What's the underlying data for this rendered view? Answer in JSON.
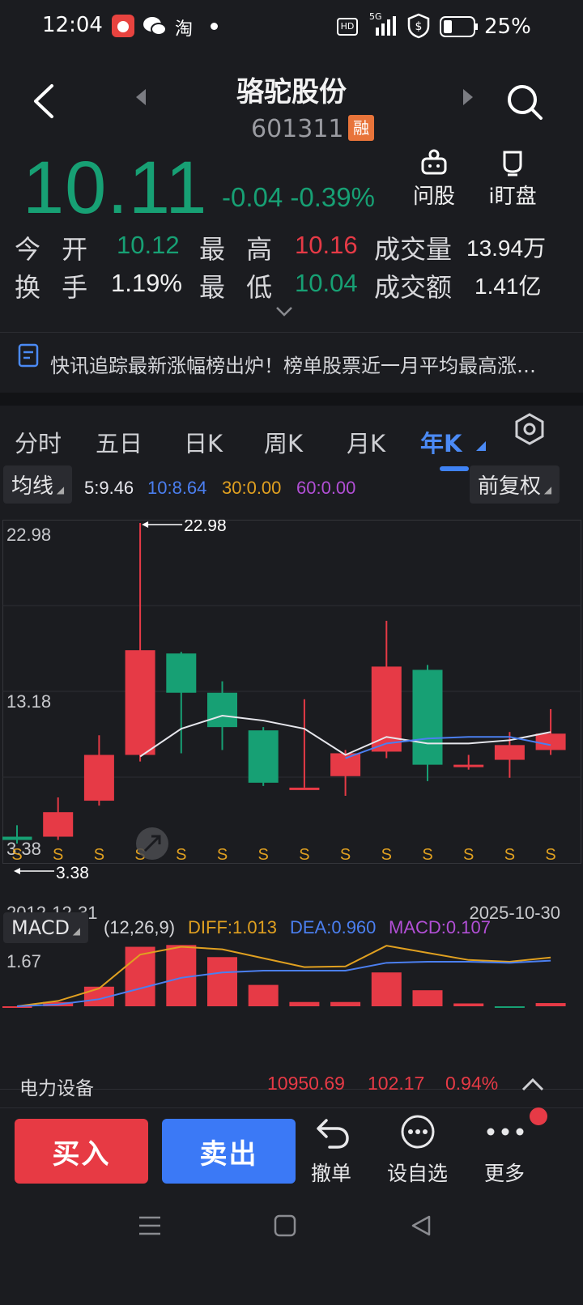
{
  "status": {
    "time": "12:04",
    "battery": "25%",
    "app_icons": [
      "app-icon",
      "wechat-icon",
      "taobao-icon"
    ],
    "taobao_label": "淘",
    "network": "5G",
    "hd": "HD"
  },
  "header": {
    "stock_name": "骆驼股份",
    "stock_code": "601311",
    "badge": "融"
  },
  "quote": {
    "price": "10.11",
    "change": "-0.04 -0.39%",
    "ask_label": "问股",
    "watch_label": "i盯盘"
  },
  "stats": {
    "open_label": "今 开",
    "open_value": "10.12",
    "high_label": "最 高",
    "high_value": "10.16",
    "volume_label": "成交量",
    "volume_value": "13.94万",
    "turnover_label": "换 手",
    "turnover_value": "1.19%",
    "low_label": "最 低",
    "low_value": "10.04",
    "amount_label": "成交额",
    "amount_value": "1.41亿"
  },
  "news": {
    "text": "快讯追踪最新涨幅榜出炉！榜单股票近一月平均最高涨…"
  },
  "tabs": [
    {
      "label": "分时"
    },
    {
      "label": "五日"
    },
    {
      "label": "日K"
    },
    {
      "label": "周K"
    },
    {
      "label": "月K"
    },
    {
      "label": "年K"
    }
  ],
  "indicators": {
    "ma_pill": "均线",
    "ma5": "5:9.46",
    "ma10": "10:8.64",
    "ma30": "30:0.00",
    "ma60": "60:0.00",
    "adjust_pill": "前复权"
  },
  "colors": {
    "up": "#e63a46",
    "down": "#17a074",
    "ma5": "#e6e6ec",
    "ma10": "#4b7ff0",
    "ma30": "#e0a020",
    "ma60": "#b24fd6",
    "blue_accent": "#3f82f4"
  },
  "chart_data": [
    {
      "type": "candlestick",
      "title": "",
      "yticks": [
        "22.98",
        "13.18",
        "3.38"
      ],
      "ylim": [
        3.38,
        22.98
      ],
      "max_annotation": "22.98",
      "min_annotation": "3.38",
      "x_start": "2012-12-31",
      "x_end": "2025-10-30",
      "marker_label": "S",
      "candles": [
        {
          "open": 3.8,
          "close": 3.6,
          "high": 4.5,
          "low": 3.38,
          "dir": "down"
        },
        {
          "open": 3.8,
          "close": 5.3,
          "high": 6.2,
          "low": 3.6,
          "dir": "up"
        },
        {
          "open": 6.0,
          "close": 8.8,
          "high": 10.0,
          "low": 5.7,
          "dir": "up"
        },
        {
          "open": 8.8,
          "close": 15.2,
          "high": 22.98,
          "low": 8.4,
          "dir": "up"
        },
        {
          "open": 15.0,
          "close": 12.6,
          "high": 15.1,
          "low": 8.9,
          "dir": "down"
        },
        {
          "open": 12.6,
          "close": 10.5,
          "high": 13.3,
          "low": 9.1,
          "dir": "down"
        },
        {
          "open": 10.3,
          "close": 7.1,
          "high": 10.5,
          "low": 6.9,
          "dir": "down"
        },
        {
          "open": 6.8,
          "close": 6.8,
          "high": 12.2,
          "low": 6.8,
          "dir": "up"
        },
        {
          "open": 7.5,
          "close": 8.9,
          "high": 9.1,
          "low": 6.3,
          "dir": "up"
        },
        {
          "open": 9.0,
          "close": 14.2,
          "high": 17.0,
          "low": 8.6,
          "dir": "up"
        },
        {
          "open": 14.0,
          "close": 8.2,
          "high": 14.3,
          "low": 7.2,
          "dir": "down"
        },
        {
          "open": 8.1,
          "close": 8.2,
          "high": 8.8,
          "low": 7.9,
          "dir": "up"
        },
        {
          "open": 8.5,
          "close": 9.4,
          "high": 10.2,
          "low": 7.4,
          "dir": "up"
        },
        {
          "open": 9.1,
          "close": 10.1,
          "high": 11.6,
          "low": 8.8,
          "dir": "up"
        }
      ],
      "ma5": [
        null,
        null,
        null,
        8.7,
        10.4,
        11.2,
        10.9,
        10.4,
        8.8,
        9.9,
        9.5,
        9.5,
        9.7,
        10.2
      ],
      "ma10": [
        null,
        null,
        null,
        null,
        null,
        null,
        null,
        null,
        8.6,
        9.5,
        9.8,
        9.9,
        9.9,
        9.4
      ]
    },
    {
      "type": "bar",
      "title": "",
      "name": "MACD",
      "params": "(12,26,9)",
      "diff_label": "DIFF:1.013",
      "dea_label": "DEA:0.960",
      "macd_label": "MACD:0.107",
      "ytick": "1.67",
      "values": [
        0.0,
        0.12,
        0.55,
        1.67,
        1.72,
        1.38,
        0.6,
        0.12,
        0.12,
        0.95,
        0.45,
        0.08,
        -0.02,
        0.09
      ],
      "diff": [
        0.0,
        0.15,
        0.5,
        1.45,
        1.67,
        1.6,
        1.35,
        1.1,
        1.12,
        1.7,
        1.5,
        1.3,
        1.25,
        1.37
      ],
      "dea": [
        0.0,
        0.05,
        0.2,
        0.5,
        0.8,
        0.95,
        1.0,
        1.0,
        1.0,
        1.22,
        1.25,
        1.25,
        1.22,
        1.28
      ]
    }
  ],
  "sector": {
    "name": "电力设备",
    "index": "10950.69",
    "change": "102.17",
    "pct": "0.94%"
  },
  "actions": {
    "buy": "买入",
    "sell": "卖出",
    "cancel": "撤单",
    "add_watch": "设自选",
    "more": "更多"
  }
}
